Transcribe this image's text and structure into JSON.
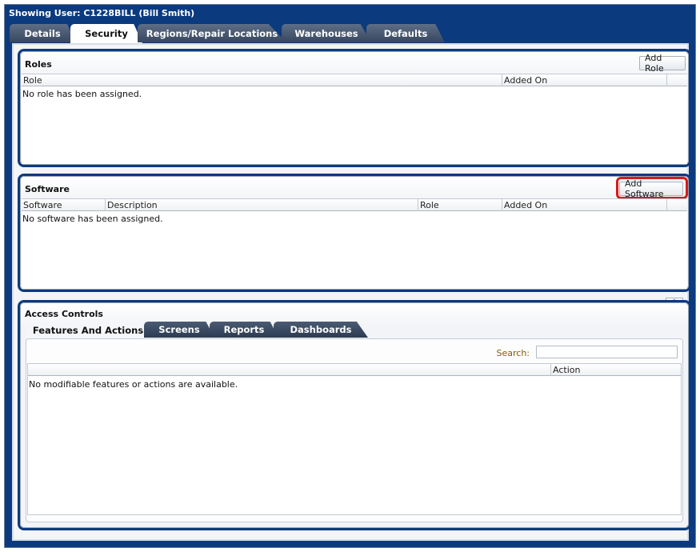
{
  "header": {
    "title": "Showing User: C1228BILL (Bill Smith)"
  },
  "tabs": [
    {
      "label": "Details"
    },
    {
      "label": "Security"
    },
    {
      "label": "Regions/Repair Locations"
    },
    {
      "label": "Warehouses"
    },
    {
      "label": "Defaults"
    }
  ],
  "active_tab": "Security",
  "roles": {
    "title": "Roles",
    "add_button": "Add Role",
    "columns": [
      "Role",
      "Added On"
    ],
    "empty_message": "No role has been assigned."
  },
  "software": {
    "title": "Software",
    "add_button": "Add Software",
    "columns": [
      "Software",
      "Description",
      "Role",
      "Added On"
    ],
    "empty_message": "No software has been assigned."
  },
  "access_controls": {
    "title": "Access Controls",
    "tabs": [
      {
        "label": "Features And Actions"
      },
      {
        "label": "Screens"
      },
      {
        "label": "Reports"
      },
      {
        "label": "Dashboards"
      }
    ],
    "active_tab": "Features And Actions",
    "search_label": "Search:",
    "search_value": "",
    "columns": [
      "",
      "Action"
    ],
    "empty_message": "No modifiable features or actions are available."
  },
  "colors": {
    "frame_blue": "#0b3a7e",
    "highlight_red": "#d61a1a",
    "search_label": "#8a5b00"
  },
  "icons": {
    "collapse": "triangle-up-icon"
  }
}
